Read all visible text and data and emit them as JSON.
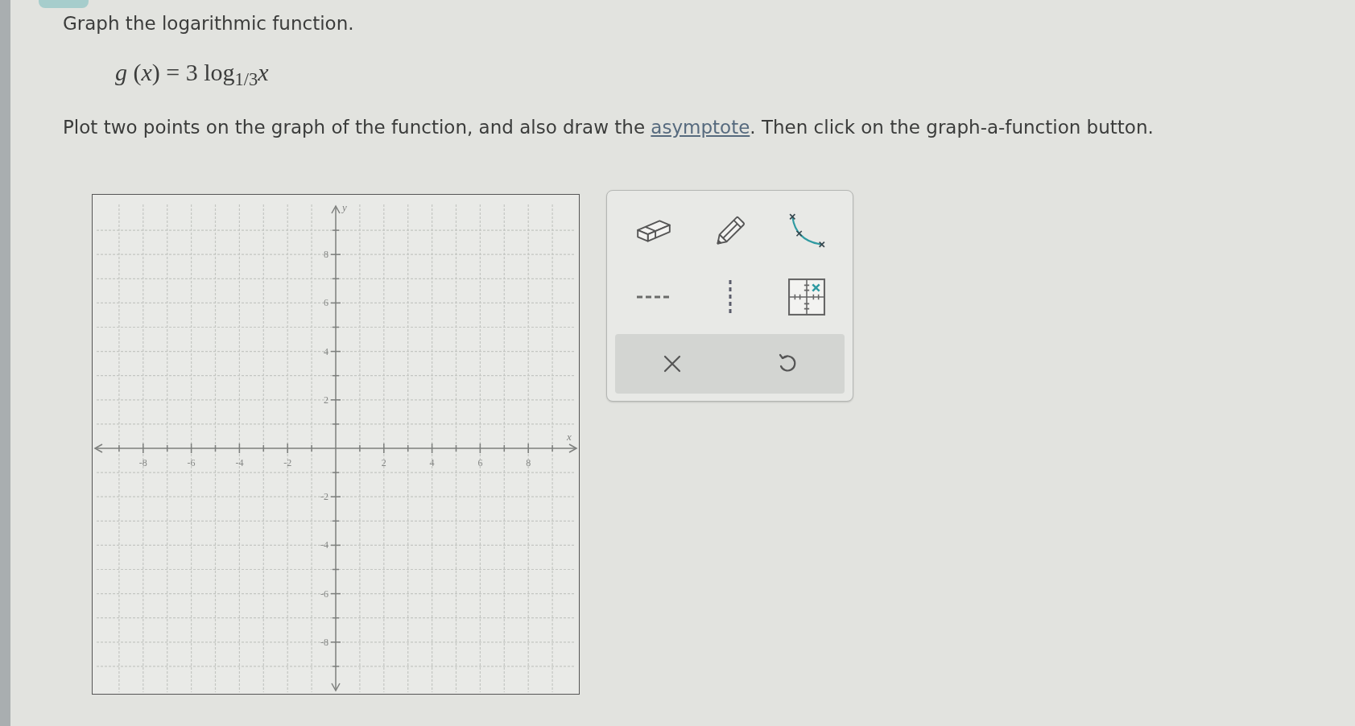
{
  "heading": "Graph the logarithmic function.",
  "formula": "*g* (*x*) = 3 log$_{1/3}$*x*",
  "instruction": {
    "text_before": "Plot two points on the graph of the function, and also draw the ",
    "link": "asymptote",
    "text_after": ". Then click on the graph-a-function button."
  },
  "graph": {
    "x_axis_label": "x",
    "y_axis_label": "y",
    "x_tick_labels": [
      "-8",
      "-6",
      "-4",
      "-2",
      "2",
      "4",
      "6",
      "8"
    ],
    "y_tick_labels": [
      "8",
      "6",
      "4",
      "2",
      "-2",
      "-4",
      "-6",
      "-8"
    ]
  }
}
